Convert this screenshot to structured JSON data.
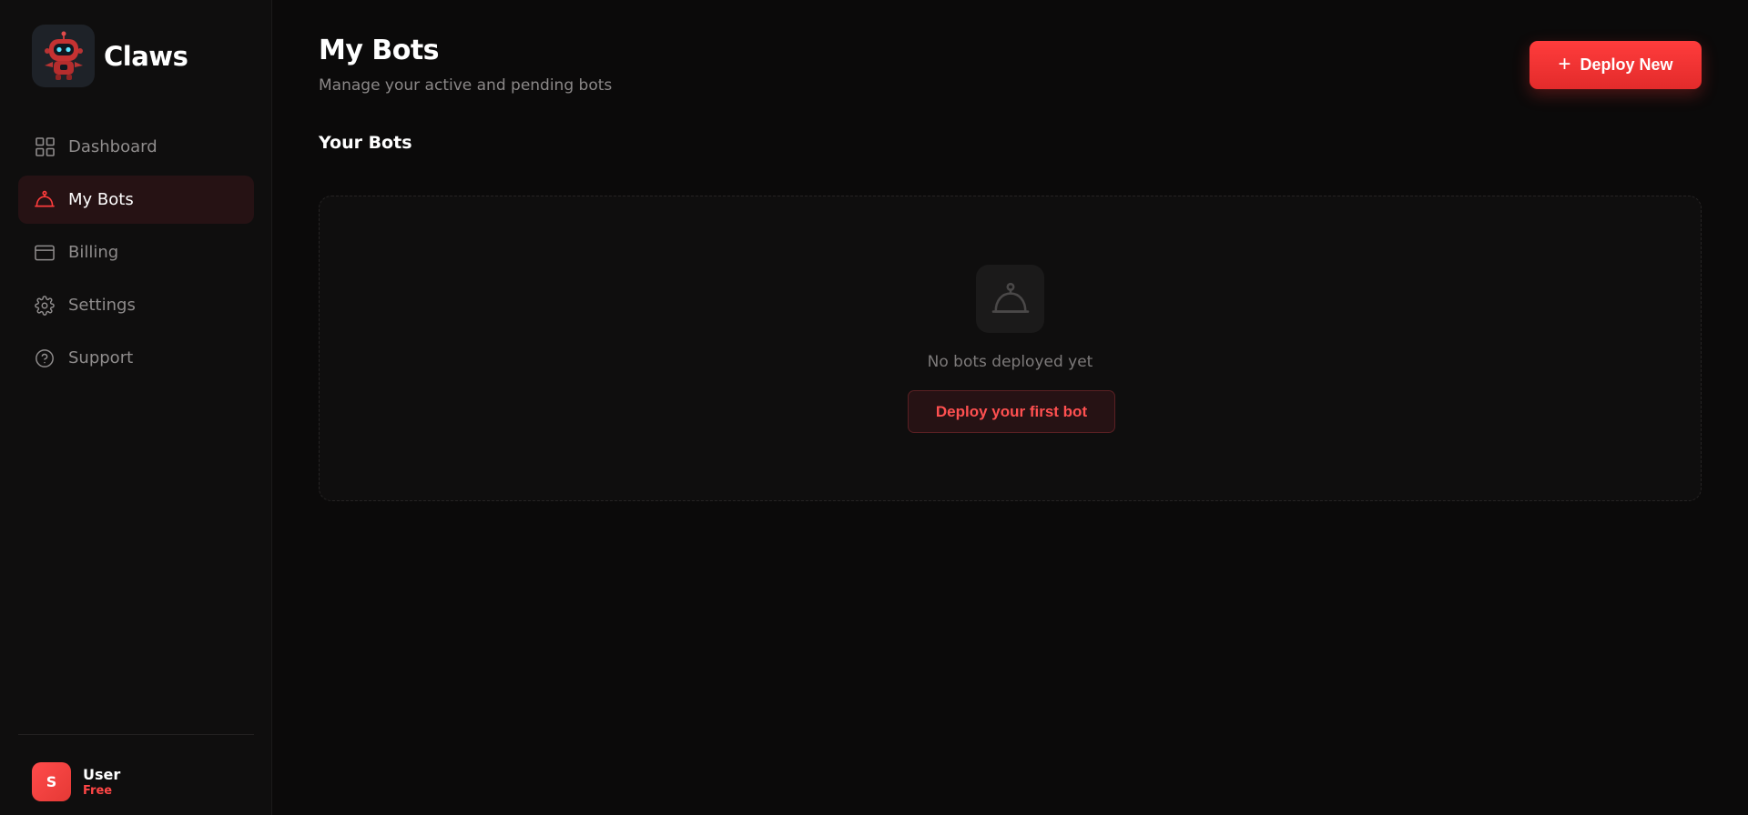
{
  "brand": {
    "name": "Claws",
    "logo_icon": "robot-logo-icon"
  },
  "sidebar": {
    "items": [
      {
        "label": "Dashboard",
        "icon": "grid-icon",
        "active": false
      },
      {
        "label": "My Bots",
        "icon": "bot-icon",
        "active": true
      },
      {
        "label": "Billing",
        "icon": "card-icon",
        "active": false
      },
      {
        "label": "Settings",
        "icon": "gear-icon",
        "active": false
      },
      {
        "label": "Support",
        "icon": "help-circle-icon",
        "active": false
      }
    ]
  },
  "user": {
    "initial": "S",
    "name": "User",
    "plan": "Free"
  },
  "header": {
    "title": "My Bots",
    "subtitle": "Manage your active and pending bots",
    "deploy_new_label": "Deploy New"
  },
  "bots": {
    "section_title": "Your Bots",
    "empty_message": "No bots deployed yet",
    "deploy_first_label": "Deploy your first bot",
    "empty_icon": "bot-icon"
  },
  "colors": {
    "accent": "#ff3c3c",
    "background": "#0b0a0a",
    "sidebar": "#0f0e0e",
    "active_item": "#261214"
  }
}
